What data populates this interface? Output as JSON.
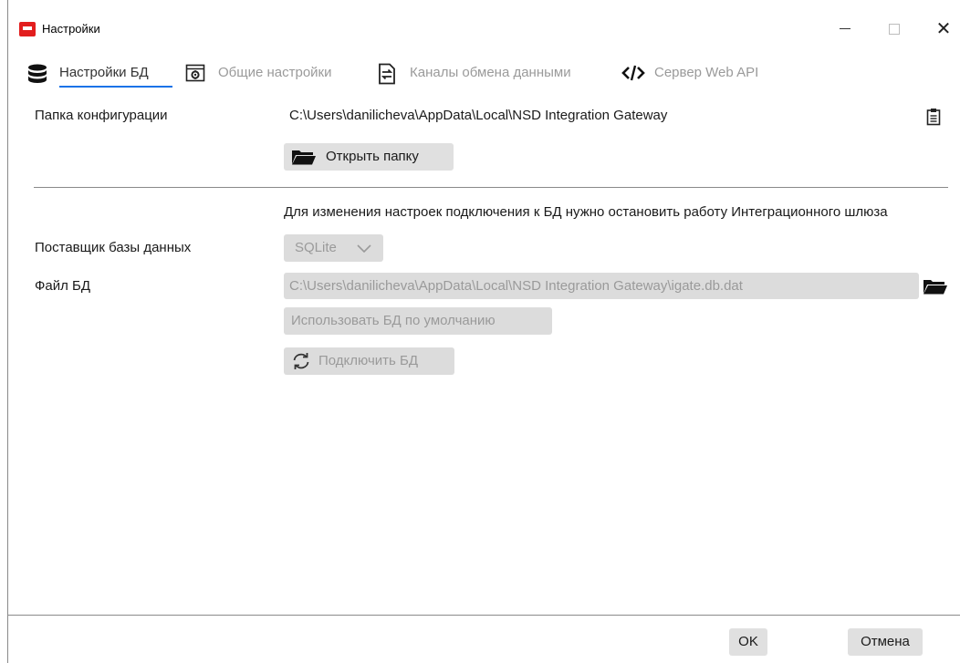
{
  "window": {
    "title": "Настройки",
    "controls": {
      "minimize": "—",
      "maximize": "□",
      "close": "✕"
    }
  },
  "tabs": [
    {
      "label": "Настройки БД",
      "icon": "database-icon",
      "active": true
    },
    {
      "label": "Общие настройки",
      "icon": "settings-window-icon",
      "active": false
    },
    {
      "label": "Каналы обмена данными",
      "icon": "exchange-document-icon",
      "active": false
    },
    {
      "label": "Сервер Web API",
      "icon": "code-icon",
      "active": false
    }
  ],
  "config": {
    "folder_label": "Папка конфигурации",
    "folder_path": "C:\\Users\\danilicheva\\AppData\\Local\\NSD Integration Gateway",
    "copy_icon": "clipboard-icon",
    "open_folder_button": "Открыть папку"
  },
  "db": {
    "notice": "Для изменения настроек подключения к БД нужно остановить работу Интеграционного шлюза",
    "provider_label": "Поставщик базы данных",
    "provider_value": "SQLite",
    "file_label": "Файл БД",
    "file_path": "C:\\Users\\danilicheva\\AppData\\Local\\NSD Integration Gateway\\igate.db.dat",
    "default_button": "Использовать БД по умолчанию",
    "connect_button": "Подключить БД"
  },
  "footer": {
    "ok": "OK",
    "cancel": "Отмена"
  },
  "colors": {
    "accent": "#1a73e8",
    "app_icon": "#e21e1e",
    "disabled_text": "#9a9a9a",
    "button_bg": "#e0e0e0"
  }
}
